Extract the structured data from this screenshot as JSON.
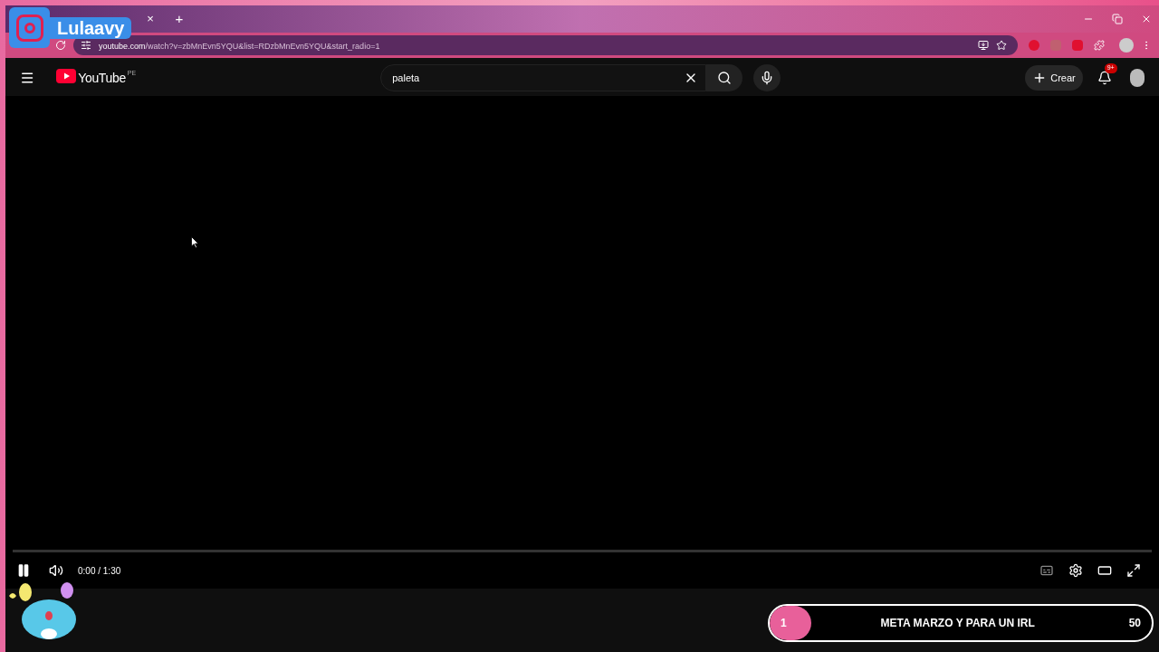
{
  "overlay": {
    "social_handle": "Lulaavy"
  },
  "browser": {
    "tab_close": "×",
    "new_tab": "+",
    "url_host": "youtube.com",
    "url_path": "/watch?v=zbMnEvn5YQU&list=RDzbMnEvn5YQU&start_radio=1"
  },
  "youtube": {
    "logo": "YouTube",
    "region": "PE",
    "search": {
      "value": "paleta"
    },
    "create_button": "Crear",
    "notification_badge": "9+"
  },
  "player": {
    "time": "0:00 / 1:30",
    "playing": true
  },
  "goal_bar": {
    "count": "1",
    "title": "META MARZO Y PARA UN IRL",
    "target": "50",
    "level": 0.02
  }
}
